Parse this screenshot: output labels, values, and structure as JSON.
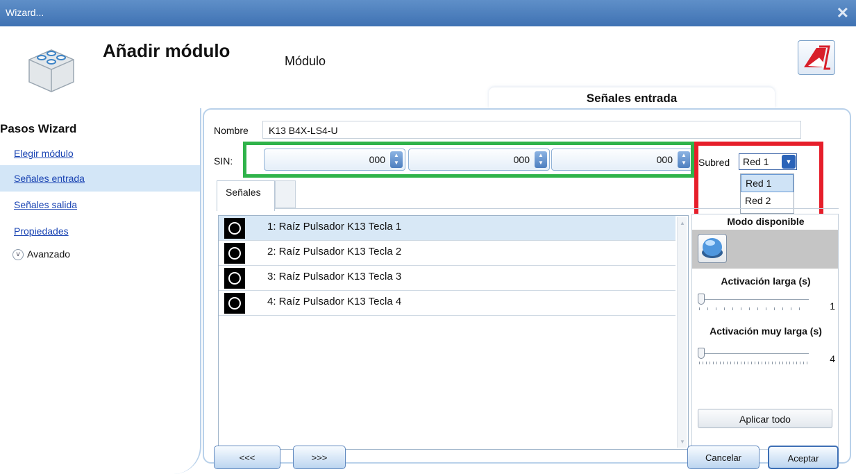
{
  "window": {
    "title": "Wizard...",
    "close_glyph": "✕"
  },
  "header": {
    "title": "Añadir módulo",
    "subtitle": "Módulo",
    "tab": "Señales entrada"
  },
  "sidebar": {
    "title": "Pasos Wizard",
    "items": [
      {
        "label": "Elegir módulo",
        "selected": false
      },
      {
        "label": "Señales entrada",
        "selected": true
      },
      {
        "label": "Señales salida",
        "selected": false
      },
      {
        "label": "Propiedades",
        "selected": false
      }
    ],
    "advanced_label": "Avanzado"
  },
  "form": {
    "name_label": "Nombre",
    "name_value": "K13 B4X-LS4-U",
    "sin_label": "SIN:",
    "sin_values": [
      "000",
      "000",
      "000"
    ],
    "subnet_label": "Subred",
    "subnet_value": "Red 1",
    "subnet_options": [
      "Red 1",
      "Red 2"
    ]
  },
  "signals": {
    "tab_label": "Señales",
    "items": [
      "1: Raíz Pulsador K13 Tecla 1",
      "2: Raíz Pulsador K13 Tecla 2",
      "3: Raíz Pulsador K13 Tecla 3",
      "4: Raíz Pulsador K13 Tecla 4"
    ]
  },
  "mode_panel": {
    "title": "Modo disponible",
    "long_label": "Activación larga (s)",
    "long_value": "1",
    "very_long_label": "Activación muy larga (s)",
    "very_long_value": "4",
    "apply_label": "Aplicar todo"
  },
  "footer": {
    "prev": "<<<",
    "next": ">>>",
    "cancel": "Cancelar",
    "accept": "Aceptar"
  },
  "colors": {
    "highlight_green": "#2fb34a",
    "highlight_red": "#e61e2a",
    "titlebar": "#4a7dbd"
  }
}
